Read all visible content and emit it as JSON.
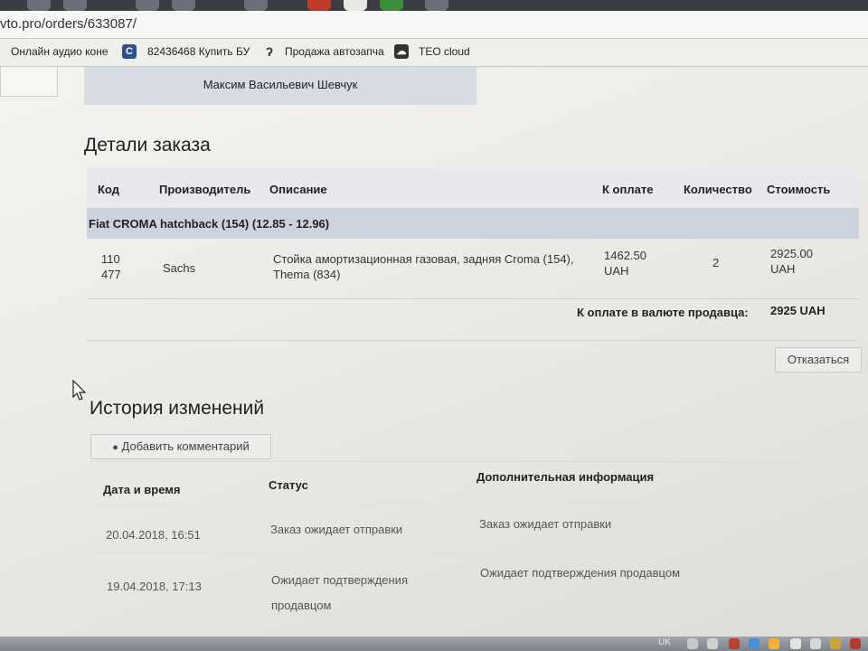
{
  "browser": {
    "url": "vto.pro/orders/633087/",
    "bookmarks": [
      {
        "label": "Онлайн аудио коне",
        "icon": "audio-icon"
      },
      {
        "label": "82436468 Купить БУ",
        "icon": "c-logo-icon"
      },
      {
        "label": "Продажа автозапча",
        "icon": "swirl-icon"
      },
      {
        "label": "TEO cloud",
        "icon": "cloud-icon"
      }
    ]
  },
  "buyer": {
    "name": "Максим Васильевич Шевчук"
  },
  "order_details": {
    "title": "Детали заказа",
    "columns": [
      "Код",
      "Производитель",
      "Описание",
      "К оплате",
      "Количество",
      "Стоимость"
    ],
    "group": "Fiat CROMA hatchback (154) (12.85 - 12.96)",
    "rows": [
      {
        "code_line1": "110",
        "code_line2": "477",
        "manufacturer": "Sachs",
        "description_line1": "Стойка амортизационная газовая, задняя Croma (154),",
        "description_line2": "Thema (834)",
        "price_line1": "1462.50",
        "price_line2": "UAH",
        "quantity": "2",
        "cost_line1": "2925.00",
        "cost_line2": "UAH"
      }
    ],
    "total_label": "К оплате в валюте продавца:",
    "total_value": "2925 UAH"
  },
  "actions": {
    "refuse_label": "Отказаться"
  },
  "history": {
    "title": "История изменений",
    "add_comment_label": "Добавить комментарий",
    "columns": [
      "Дата и время",
      "Статус",
      "Дополнительная информация"
    ],
    "rows": [
      {
        "datetime": "20.04.2018, 16:51",
        "status_line1": "Заказ ожидает отправки",
        "status_line2": "",
        "info": "Заказ ожидает отправки"
      },
      {
        "datetime": "19.04.2018, 17:13",
        "status_line1": "Ожидает подтверждения",
        "status_line2": "продавцом",
        "info": "Ожидает подтверждения продавцом"
      }
    ]
  },
  "taskbar": {
    "language": "UK"
  }
}
